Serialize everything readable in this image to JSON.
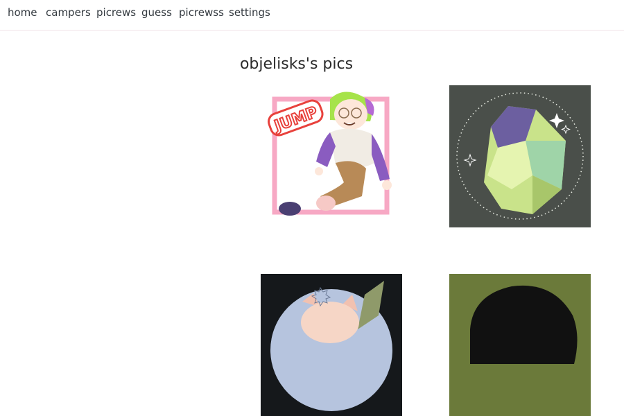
{
  "nav": {
    "items": [
      {
        "label": "home"
      },
      {
        "label": "campers"
      },
      {
        "label": "picrews"
      },
      {
        "label": "guess"
      },
      {
        "label": "picrewss"
      },
      {
        "label": "settings"
      }
    ]
  },
  "main": {
    "title": "objelisks's pics"
  },
  "colors": {
    "pink_frame": "#f7a8c4",
    "jump_red": "#e8413c",
    "crystal_bg": "#4a4f4a",
    "olive_bg": "#6b7a3a",
    "dark_bg": "#15181b"
  },
  "pics": [
    {
      "content": "picrew-avatar-jump"
    },
    {
      "content": "picrew-crystal"
    },
    {
      "content": "picrew-cat-portrait"
    },
    {
      "content": "picrew-silhouette"
    }
  ]
}
